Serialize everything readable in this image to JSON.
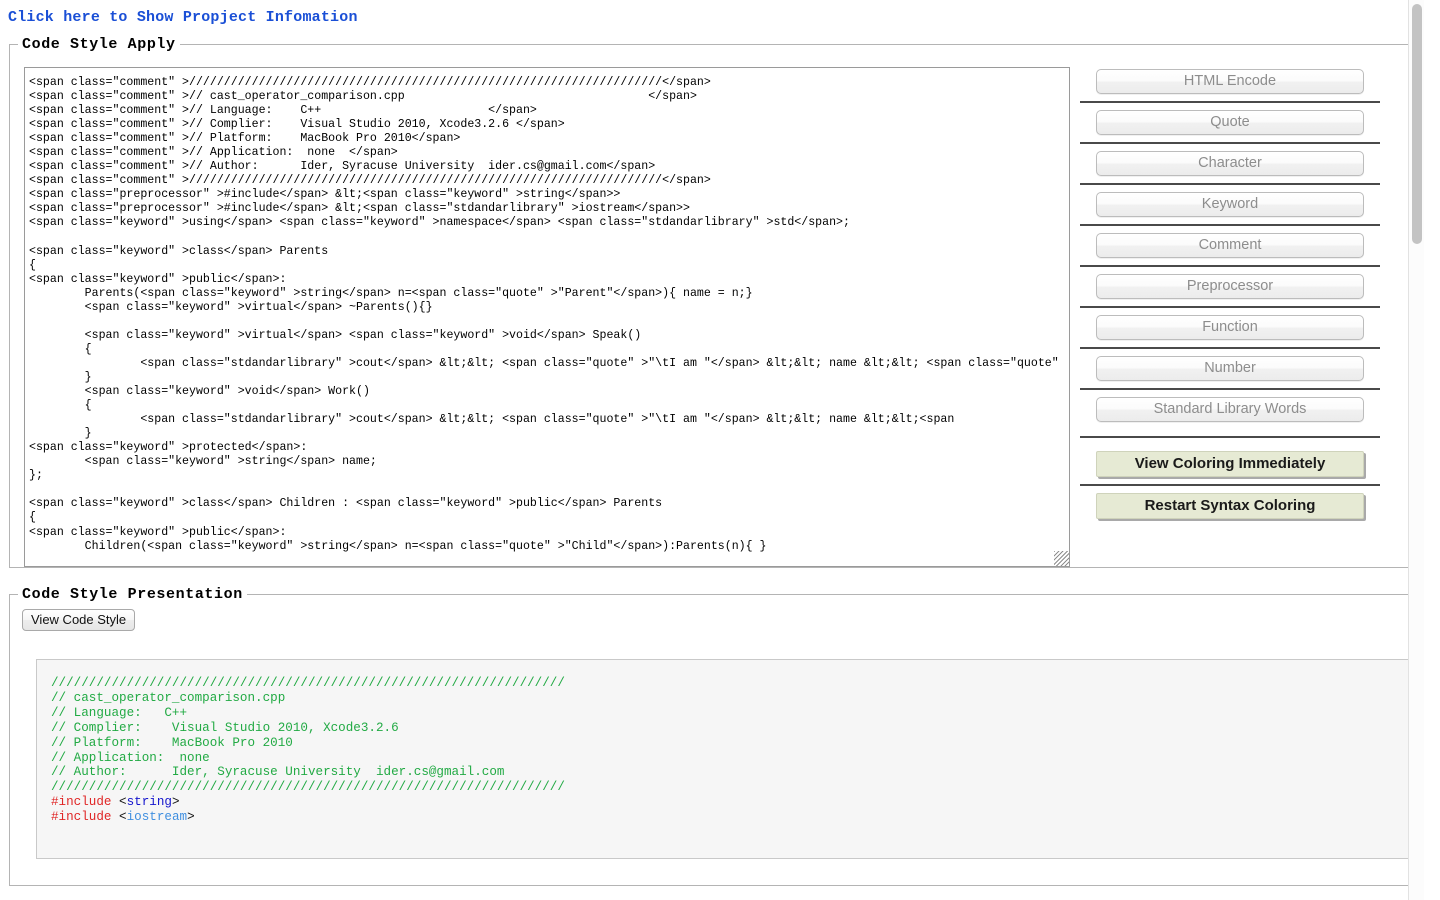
{
  "header": {
    "link_label": "Click here to Show Propject Infomation"
  },
  "apply_panel": {
    "legend": "Code Style Apply",
    "textarea_value": "<span class=\"comment\" >////////////////////////////////////////////////////////////////////</span>\n<span class=\"comment\" >// cast_operator_comparison.cpp                                   </span>\n<span class=\"comment\" >// Language:    C++                        </span>\n<span class=\"comment\" >// Complier:    Visual Studio 2010, Xcode3.2.6 </span>\n<span class=\"comment\" >// Platform:    MacBook Pro 2010</span>\n<span class=\"comment\" >// Application:  none  </span>\n<span class=\"comment\" >// Author:      Ider, Syracuse University  ider.cs@gmail.com</span>\n<span class=\"comment\" >////////////////////////////////////////////////////////////////////</span>\n<span class=\"preprocessor\" >#include</span> &lt;<span class=\"keyword\" >string</span>>\n<span class=\"preprocessor\" >#include</span> &lt;<span class=\"stdandarlibrary\" >iostream</span>>\n<span class=\"keyword\" >using</span> <span class=\"keyword\" >namespace</span> <span class=\"stdandarlibrary\" >std</span>;\n\n<span class=\"keyword\" >class</span> Parents\n{\n<span class=\"keyword\" >public</span>:\n        Parents(<span class=\"keyword\" >string</span> n=<span class=\"quote\" >\"Parent\"</span>){ name = n;}\n        <span class=\"keyword\" >virtual</span> ~Parents(){}\n\n        <span class=\"keyword\" >virtual</span> <span class=\"keyword\" >void</span> Speak()\n        {\n                <span class=\"stdandarlibrary\" >cout</span> &lt;&lt; <span class=\"quote\" >\"\\tI am \"</span> &lt;&lt; name &lt;&lt; <span class=\"quote\"\n        }\n        <span class=\"keyword\" >void</span> Work()\n        {\n                <span class=\"stdandarlibrary\" >cout</span> &lt;&lt; <span class=\"quote\" >\"\\tI am \"</span> &lt;&lt; name &lt;&lt;<span\n        }\n<span class=\"keyword\" >protected</span>:\n        <span class=\"keyword\" >string</span> name;\n};\n\n<span class=\"keyword\" >class</span> Children : <span class=\"keyword\" >public</span> Parents\n{\n<span class=\"keyword\" >public</span>:\n        Children(<span class=\"keyword\" >string</span> n=<span class=\"quote\" >\"Child\"</span>):Parents(n){ }",
    "buttons": [
      {
        "label": "HTML Encode",
        "name": "html-encode-button"
      },
      {
        "label": "Quote",
        "name": "quote-button"
      },
      {
        "label": "Character",
        "name": "character-button"
      },
      {
        "label": "Keyword",
        "name": "keyword-button"
      },
      {
        "label": "Comment",
        "name": "comment-button"
      },
      {
        "label": "Preprocessor",
        "name": "preprocessor-button"
      },
      {
        "label": "Function",
        "name": "function-button"
      },
      {
        "label": "Number",
        "name": "number-button"
      },
      {
        "label": "Standard Library Words",
        "name": "standard-library-words-button"
      }
    ],
    "action_buttons": [
      {
        "label": "View Coloring Immediately",
        "name": "view-coloring-immediately-button"
      },
      {
        "label": "Restart Syntax Coloring",
        "name": "restart-syntax-coloring-button"
      }
    ]
  },
  "presentation_panel": {
    "legend": "Code Style Presentation",
    "view_button_label": "View Code Style",
    "code_lines": [
      {
        "segments": [
          {
            "text": "////////////////////////////////////////////////////////////////////",
            "cls": "comment"
          }
        ]
      },
      {
        "segments": [
          {
            "text": "// cast_operator_comparison.cpp",
            "cls": "comment"
          }
        ]
      },
      {
        "segments": [
          {
            "text": "// Language:   C++",
            "cls": "comment"
          }
        ]
      },
      {
        "segments": [
          {
            "text": "// Complier:    Visual Studio 2010, Xcode3.2.6",
            "cls": "comment"
          }
        ]
      },
      {
        "segments": [
          {
            "text": "// Platform:    MacBook Pro 2010",
            "cls": "comment"
          }
        ]
      },
      {
        "segments": [
          {
            "text": "// Application:  none",
            "cls": "comment"
          }
        ]
      },
      {
        "segments": [
          {
            "text": "// Author:      Ider, Syracuse University  ider.cs@gmail.com",
            "cls": "comment"
          }
        ]
      },
      {
        "segments": [
          {
            "text": "////////////////////////////////////////////////////////////////////",
            "cls": "comment"
          }
        ]
      },
      {
        "segments": [
          {
            "text": "#include",
            "cls": "preprocessor"
          },
          {
            "text": " <",
            "cls": "plain"
          },
          {
            "text": "string",
            "cls": "keyword"
          },
          {
            "text": ">",
            "cls": "plain"
          }
        ]
      },
      {
        "segments": [
          {
            "text": "#include",
            "cls": "preprocessor"
          },
          {
            "text": " <",
            "cls": "plain"
          },
          {
            "text": "iostream",
            "cls": "stdlib"
          },
          {
            "text": ">",
            "cls": "plain"
          }
        ]
      }
    ]
  },
  "colors": {
    "link": "#1a4fd6",
    "comment": "#22aa44",
    "preprocessor": "#e02626",
    "keyword": "#1414cc",
    "stdlib": "#3f8fe0",
    "green_button_bg": "#e6ead4",
    "disabled_button_text": "#8d8d8d"
  }
}
